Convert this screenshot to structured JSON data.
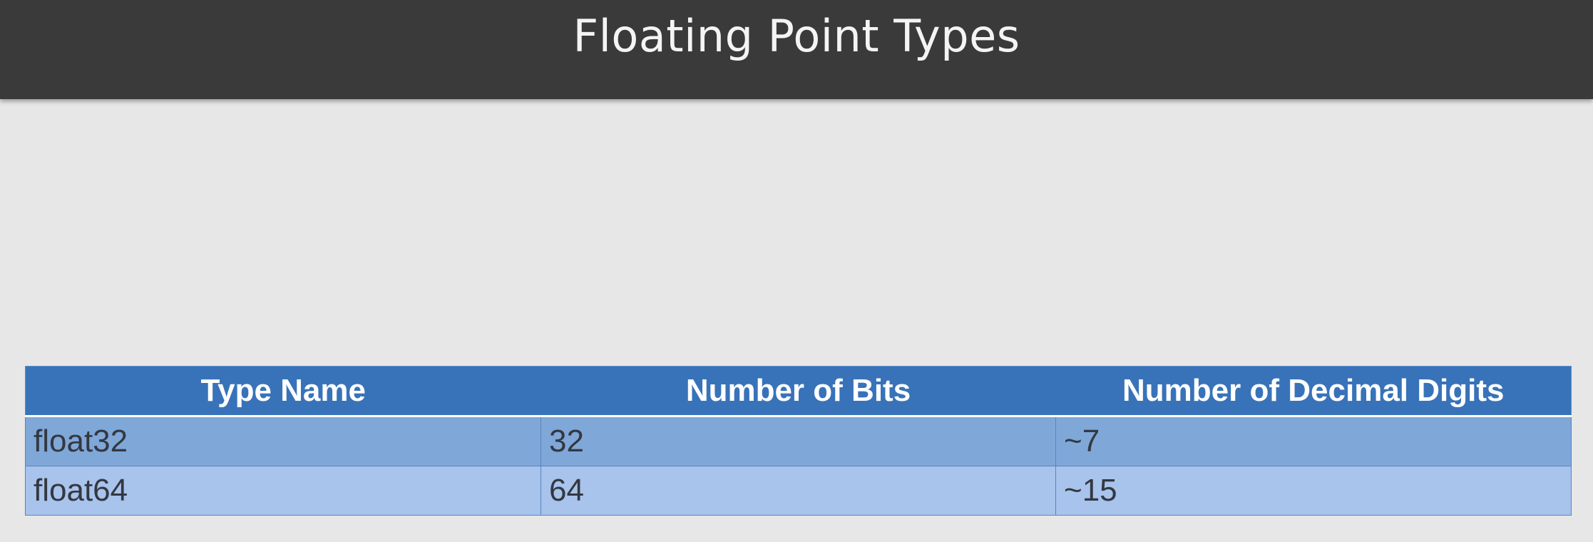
{
  "slide": {
    "title": "Floating Point Types"
  },
  "table": {
    "headers": [
      "Type Name",
      "Number of Bits",
      "Number of Decimal Digits"
    ],
    "rows": [
      [
        "float32",
        "32",
        "~7"
      ],
      [
        "float64",
        "64",
        "~15"
      ]
    ]
  },
  "colors": {
    "title_bar": "#3a3a3a",
    "background": "#e7e7e7",
    "header_fill": "#3873b9",
    "row_odd_fill": "#7fa7d8",
    "row_even_fill": "#a8c3ec"
  }
}
